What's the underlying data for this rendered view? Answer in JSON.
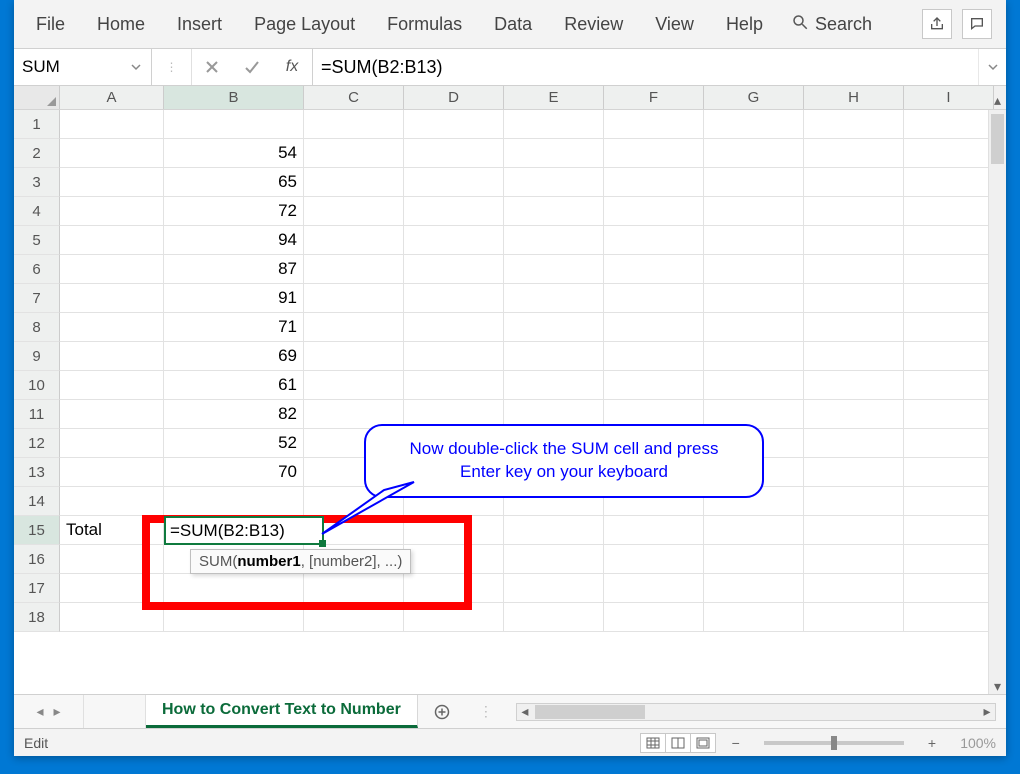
{
  "ribbon": {
    "tabs": [
      "File",
      "Home",
      "Insert",
      "Page Layout",
      "Formulas",
      "Data",
      "Review",
      "View",
      "Help"
    ],
    "search_label": "Search"
  },
  "formula_bar": {
    "namebox": "SUM",
    "fx_label": "fx",
    "formula": "=SUM(B2:B13)"
  },
  "columns": [
    "A",
    "B",
    "C",
    "D",
    "E",
    "F",
    "G",
    "H",
    "I"
  ],
  "rows": {
    "count": 18,
    "active": 15
  },
  "cells": {
    "B2": "54",
    "B3": "65",
    "B4": "72",
    "B5": "94",
    "B6": "87",
    "B7": "91",
    "B8": "71",
    "B9": "69",
    "B10": "61",
    "B11": "82",
    "B12": "52",
    "B13": "70",
    "A15": "Total",
    "B15_edit": "=SUM(B2:B13)"
  },
  "tooltip": {
    "prefix": "SUM(",
    "bold": "number1",
    "suffix": ", [number2], ...)"
  },
  "callout": {
    "line1": "Now double-click the SUM cell and press",
    "line2": "Enter key on your keyboard"
  },
  "sheet": {
    "name": "How to Convert Text to Number"
  },
  "status": {
    "mode": "Edit",
    "zoom": "100%"
  }
}
